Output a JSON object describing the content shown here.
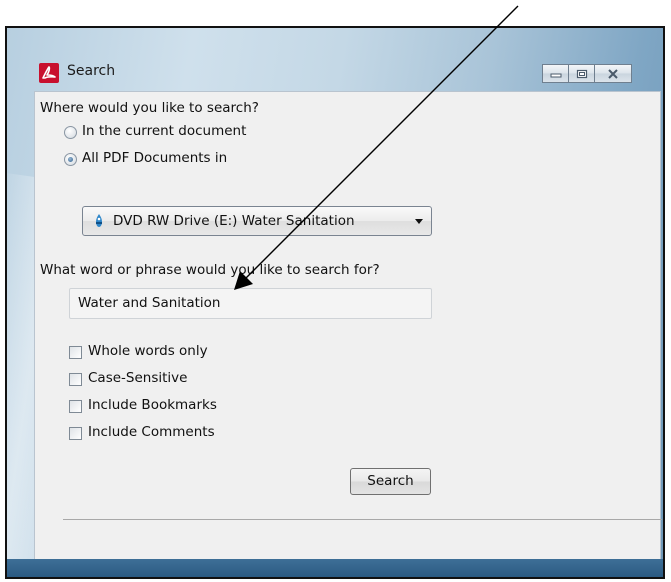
{
  "window": {
    "title": "Search",
    "app_icon": "adobe-pdf-icon",
    "controls": [
      "minimize-icon",
      "maximize-icon",
      "close-icon"
    ]
  },
  "where": {
    "question": "Where would you like to search?",
    "options": [
      "In the current document",
      "All PDF Documents in"
    ],
    "selected_option": "All PDF Documents in",
    "location": {
      "icon": "dvd-drive-icon",
      "value": "DVD RW Drive (E:) Water Sanitation"
    }
  },
  "phrase": {
    "question": "What word or phrase would you like to search for?",
    "value": "Water and Sanitation"
  },
  "options": {
    "whole_words": {
      "label": "Whole words only",
      "checked": false
    },
    "case_sensitive": {
      "label": "Case-Sensitive",
      "checked": false
    },
    "bookmarks": {
      "label": "Include Bookmarks",
      "checked": false
    },
    "comments": {
      "label": "Include Comments",
      "checked": false
    }
  },
  "actions": {
    "search_label": "Search"
  },
  "annotation": {
    "icon": "pointer-arrow",
    "color": "#000000"
  }
}
